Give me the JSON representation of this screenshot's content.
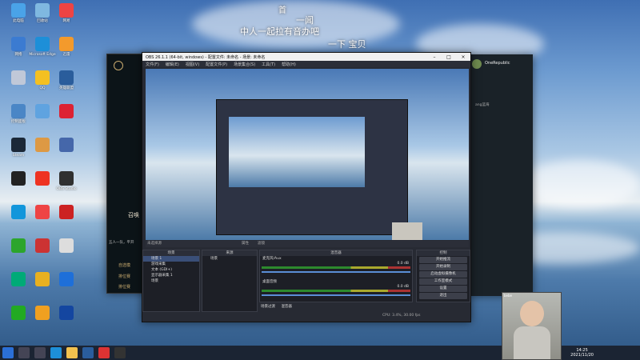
{
  "desktop": {
    "lyrics": [
      "首",
      "一闻",
      "中人一起拉有音办吧",
      "一下 宝贝"
    ],
    "icons": [
      {
        "label": "此电脑",
        "color": "#4aa3e8"
      },
      {
        "label": "回收站",
        "color": "#7fb8e0"
      },
      {
        "label": "网易",
        "color": "#e44"
      },
      {
        "label": "网络",
        "color": "#3b7bd1"
      },
      {
        "label": "Microsoft Edge",
        "color": "#1d8fd8"
      },
      {
        "label": "迅雷",
        "color": "#f39a2c"
      },
      {
        "label": "",
        "color": "#c0c8d8"
      },
      {
        "label": "QQ",
        "color": "#f4c021"
      },
      {
        "label": "英雄联盟",
        "color": "#2a5d9c"
      },
      {
        "label": "控制面板",
        "color": "#4a86c6"
      },
      {
        "label": "",
        "color": "#5fa3e0"
      },
      {
        "label": "",
        "color": "#d23"
      },
      {
        "label": "Steam",
        "color": "#1b2838"
      },
      {
        "label": "",
        "color": "#d94"
      },
      {
        "label": "",
        "color": "#4567aa"
      },
      {
        "label": "",
        "color": "#222"
      },
      {
        "label": "",
        "color": "#e32"
      },
      {
        "label": "OBS Studio",
        "color": "#303030"
      },
      {
        "label": "",
        "color": "#1296db"
      },
      {
        "label": "",
        "color": "#e44"
      },
      {
        "label": "",
        "color": "#c22"
      },
      {
        "label": "",
        "color": "#2ca52c"
      },
      {
        "label": "",
        "color": "#c33"
      },
      {
        "label": "",
        "color": "#ddd"
      },
      {
        "label": "",
        "color": "#0a7"
      },
      {
        "label": "",
        "color": "#e8b020"
      },
      {
        "label": "",
        "color": "#1e6fd9"
      },
      {
        "label": "",
        "color": "#2a2"
      },
      {
        "label": "",
        "color": "#f0a020"
      },
      {
        "label": "",
        "color": "#1446a0"
      }
    ]
  },
  "league": {
    "title": "召唤",
    "options": [
      "自选模",
      "排位赛",
      "排位赛"
    ],
    "note": "五人一队，平开"
  },
  "chat": {
    "user": "OneRepublic",
    "items": [
      "ang蓝海",
      "",
      "",
      "",
      "",
      ""
    ]
  },
  "obs": {
    "title": "OBS 26.1.1 (64-bit, windows) - 配置文件: 未命名 - 场景: 未命名",
    "menu": [
      "文件(F)",
      "编辑(E)",
      "视图(V)",
      "配置文件(P)",
      "场景集合(S)",
      "工具(T)",
      "帮助(H)"
    ],
    "scene_label": "未选择源",
    "tabs_center": [
      "属性",
      "滤镜"
    ],
    "panels": {
      "scenes": "场景",
      "sources": "来源",
      "mixer": "混音器",
      "controls": "控制"
    },
    "scenes": [
      "场景 1",
      "游戏采集",
      "文本 (GDI+)",
      "显示器采集 1",
      "场景"
    ],
    "sources": [
      "场景"
    ],
    "mixer": [
      {
        "name": "麦克风/Aux",
        "db": "0.0 dB"
      },
      {
        "name": "桌面音频",
        "db": "0.0 dB"
      }
    ],
    "controls": [
      "开始推流",
      "开始录制",
      "启动虚拟摄像机",
      "工作室模式",
      "设置",
      "退出"
    ],
    "bottom_tabs": [
      "场景过渡",
      "混音器"
    ],
    "status": "CPU: 3.4%, 30.00 fps"
  },
  "taskbar": {
    "time": "14:25",
    "date": "2021/11/20"
  },
  "webcam": {
    "label": "bebe"
  }
}
